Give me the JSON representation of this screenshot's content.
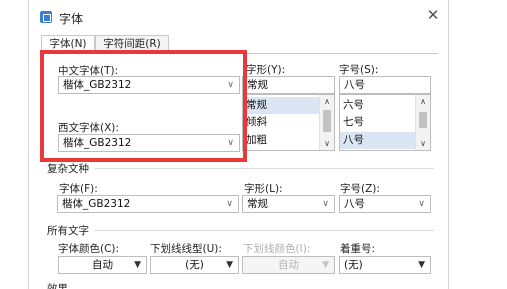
{
  "window": {
    "title": "字体",
    "close_icon": "close-icon"
  },
  "tabs": [
    {
      "label": "字体(N)"
    },
    {
      "label": "字符间距(R)"
    }
  ],
  "chinese_font": {
    "label": "中文字体(T):",
    "value": "楷体_GB2312"
  },
  "western_font": {
    "label": "西文字体(X):",
    "value": "楷体_GB2312"
  },
  "style": {
    "label": "字形(Y):",
    "value": "常规",
    "items": [
      "常规",
      "倾斜",
      "加粗"
    ],
    "selected_index": 0
  },
  "size": {
    "label": "字号(S):",
    "value": "八号",
    "items": [
      "六号",
      "七号",
      "八号"
    ],
    "selected_index": 2
  },
  "complex_script": {
    "heading": "复杂文种",
    "font_label": "字体(F):",
    "font_value": "楷体_GB2312",
    "style_label": "字形(L):",
    "style_value": "常规",
    "size_label": "字号(Z):",
    "size_value": "八号"
  },
  "all_text": {
    "heading": "所有文字",
    "font_color_label": "字体颜色(C):",
    "font_color_value": "自动",
    "underline_type_label": "下划线线型(U):",
    "underline_type_value": "(无)",
    "underline_color_label": "下划线颜色(I):",
    "underline_color_value": "自动",
    "emphasis_label": "着重号:",
    "emphasis_value": "(无)"
  },
  "effects": {
    "heading": "效果"
  },
  "colors": {
    "highlight": "#e8383b",
    "selection": "#dbe6f5"
  }
}
